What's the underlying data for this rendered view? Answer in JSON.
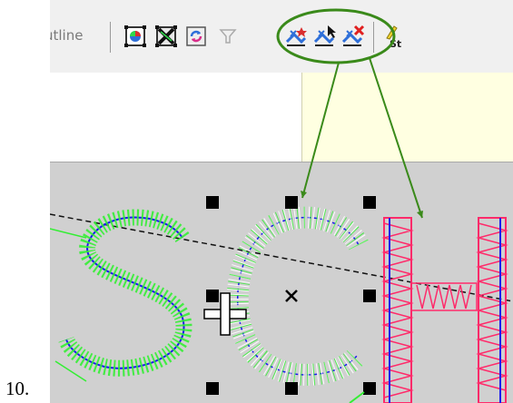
{
  "page_number": "10.",
  "toolbar": {
    "label": "utline"
  },
  "icons": {
    "tb1": "select-color-icon",
    "tb2": "delete-object-icon",
    "tb3": "refresh-icon",
    "tb4": "filter-icon",
    "tb5": "add-stitch-icon",
    "tb6": "select-stitch-icon",
    "tb7": "remove-stitch-icon",
    "tb8": "stitch-tool-icon"
  },
  "colors": {
    "green_stitch": "#33ee33",
    "blue_outline": "#1a1aee",
    "red_stitch": "#ff2a6a",
    "annotation_green": "#3a8a1a",
    "canvas": "#d0d0d0"
  }
}
